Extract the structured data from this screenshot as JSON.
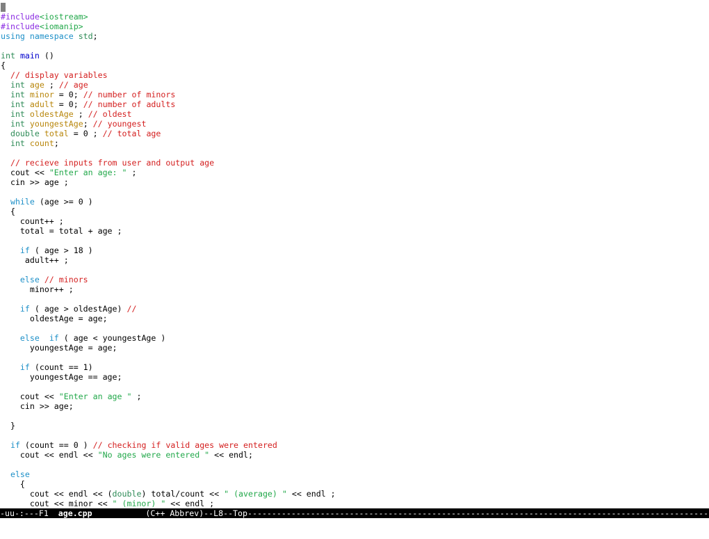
{
  "colors": {
    "preprocessor": "#8a2be2",
    "keyword": "#1e90c8",
    "type": "#2e8b57",
    "function": "#0000cd",
    "variable": "#b8860b",
    "comment": "#d42020",
    "string": "#22a84a",
    "default": "#000000"
  },
  "editor": {
    "lines": [
      [],
      [
        {
          "t": "#include",
          "c": "preprocessor"
        },
        {
          "t": "<iostream>",
          "c": "string"
        }
      ],
      [
        {
          "t": "#include",
          "c": "preprocessor"
        },
        {
          "t": "<iomanip>",
          "c": "string"
        }
      ],
      [
        {
          "t": "using",
          "c": "keyword"
        },
        {
          "t": " "
        },
        {
          "t": "namespace",
          "c": "keyword"
        },
        {
          "t": " "
        },
        {
          "t": "std",
          "c": "type"
        },
        {
          "t": ";"
        }
      ],
      [],
      [
        {
          "t": "int",
          "c": "type"
        },
        {
          "t": " "
        },
        {
          "t": "main",
          "c": "function"
        },
        {
          "t": " ()"
        }
      ],
      [
        {
          "t": "{"
        }
      ],
      [
        {
          "t": "  "
        },
        {
          "t": "// display variables",
          "c": "comment"
        }
      ],
      [
        {
          "t": "  "
        },
        {
          "t": "int",
          "c": "type"
        },
        {
          "t": " "
        },
        {
          "t": "age",
          "c": "variable"
        },
        {
          "t": " ; "
        },
        {
          "t": "// age",
          "c": "comment"
        }
      ],
      [
        {
          "t": "  "
        },
        {
          "t": "int",
          "c": "type"
        },
        {
          "t": " "
        },
        {
          "t": "minor",
          "c": "variable"
        },
        {
          "t": " = 0; "
        },
        {
          "t": "// number of minors",
          "c": "comment"
        }
      ],
      [
        {
          "t": "  "
        },
        {
          "t": "int",
          "c": "type"
        },
        {
          "t": " "
        },
        {
          "t": "adult",
          "c": "variable"
        },
        {
          "t": " = 0; "
        },
        {
          "t": "// number of adults",
          "c": "comment"
        }
      ],
      [
        {
          "t": "  "
        },
        {
          "t": "int",
          "c": "type"
        },
        {
          "t": " "
        },
        {
          "t": "oldestAge",
          "c": "variable"
        },
        {
          "t": " ; "
        },
        {
          "t": "// oldest",
          "c": "comment"
        }
      ],
      [
        {
          "t": "  "
        },
        {
          "t": "int",
          "c": "type"
        },
        {
          "t": " "
        },
        {
          "t": "youngestAge",
          "c": "variable"
        },
        {
          "t": "; "
        },
        {
          "t": "// youngest",
          "c": "comment"
        }
      ],
      [
        {
          "t": "  "
        },
        {
          "t": "double",
          "c": "type"
        },
        {
          "t": " "
        },
        {
          "t": "total",
          "c": "variable"
        },
        {
          "t": " = 0 ; "
        },
        {
          "t": "// total age",
          "c": "comment"
        }
      ],
      [
        {
          "t": "  "
        },
        {
          "t": "int",
          "c": "type"
        },
        {
          "t": " "
        },
        {
          "t": "count",
          "c": "variable"
        },
        {
          "t": ";"
        }
      ],
      [],
      [
        {
          "t": "  "
        },
        {
          "t": "// recieve inputs from user and output age",
          "c": "comment"
        }
      ],
      [
        {
          "t": "  cout << "
        },
        {
          "t": "\"Enter an age: \"",
          "c": "string"
        },
        {
          "t": " ;"
        }
      ],
      [
        {
          "t": "  cin >> age ;"
        }
      ],
      [],
      [
        {
          "t": "  "
        },
        {
          "t": "while",
          "c": "keyword"
        },
        {
          "t": " (age >= 0 )"
        }
      ],
      [
        {
          "t": "  {"
        }
      ],
      [
        {
          "t": "    count++ ;"
        }
      ],
      [
        {
          "t": "    total = total + age ;"
        }
      ],
      [],
      [
        {
          "t": "    "
        },
        {
          "t": "if",
          "c": "keyword"
        },
        {
          "t": " ( age > 18 )"
        }
      ],
      [
        {
          "t": "     adult++ ;"
        }
      ],
      [],
      [
        {
          "t": "    "
        },
        {
          "t": "else",
          "c": "keyword"
        },
        {
          "t": " "
        },
        {
          "t": "// minors",
          "c": "comment"
        }
      ],
      [
        {
          "t": "      minor++ ;"
        }
      ],
      [],
      [
        {
          "t": "    "
        },
        {
          "t": "if",
          "c": "keyword"
        },
        {
          "t": " ( age > oldestAge) "
        },
        {
          "t": "//",
          "c": "comment"
        }
      ],
      [
        {
          "t": "      oldestAge = age;"
        }
      ],
      [],
      [
        {
          "t": "    "
        },
        {
          "t": "else",
          "c": "keyword"
        },
        {
          "t": "  "
        },
        {
          "t": "if",
          "c": "keyword"
        },
        {
          "t": " ( age < youngestAge )"
        }
      ],
      [
        {
          "t": "      youngestAge = age;"
        }
      ],
      [],
      [
        {
          "t": "    "
        },
        {
          "t": "if",
          "c": "keyword"
        },
        {
          "t": " (count == 1)"
        }
      ],
      [
        {
          "t": "      youngestAge == age;"
        }
      ],
      [],
      [
        {
          "t": "    cout << "
        },
        {
          "t": "\"Enter an age \"",
          "c": "string"
        },
        {
          "t": " ;"
        }
      ],
      [
        {
          "t": "    cin >> age;"
        }
      ],
      [],
      [
        {
          "t": "  }"
        }
      ],
      [],
      [
        {
          "t": "  "
        },
        {
          "t": "if",
          "c": "keyword"
        },
        {
          "t": " (count == 0 ) "
        },
        {
          "t": "// checking if valid ages were entered",
          "c": "comment"
        }
      ],
      [
        {
          "t": "    cout << endl << "
        },
        {
          "t": "\"No ages were entered \"",
          "c": "string"
        },
        {
          "t": " << endl;"
        }
      ],
      [],
      [
        {
          "t": "  "
        },
        {
          "t": "else",
          "c": "keyword"
        }
      ],
      [
        {
          "t": "    {"
        }
      ],
      [
        {
          "t": "      cout << endl << ("
        },
        {
          "t": "double",
          "c": "type"
        },
        {
          "t": ") total/count << "
        },
        {
          "t": "\" (average) \"",
          "c": "string"
        },
        {
          "t": " << endl ;"
        }
      ],
      [
        {
          "t": "      cout << minor << "
        },
        {
          "t": "\" (minor) \"",
          "c": "string"
        },
        {
          "t": " << endl ;"
        }
      ]
    ]
  },
  "modeline": {
    "status": "-uu-:---F1  ",
    "filename": "age.cpp",
    "gap": "           ",
    "mode": "(C++ Abbrev)--L8--Top",
    "fill": "----------------------------------------------------------------------------------------------------"
  }
}
